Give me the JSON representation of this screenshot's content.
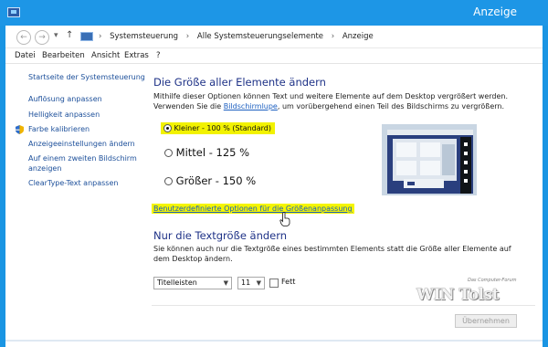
{
  "window": {
    "title": "Anzeige"
  },
  "nav": {
    "back_glyph": "←",
    "forward_glyph": "→",
    "dropdown_glyph": "▾",
    "up_glyph": "↑",
    "breadcrumb": [
      "Systemsteuerung",
      "Alle Systemsteuerungselemente",
      "Anzeige"
    ],
    "separator": "›"
  },
  "menu": [
    "Datei",
    "Bearbeiten",
    "Ansicht",
    "Extras",
    "?"
  ],
  "sidebar": {
    "home": "Startseite der Systemsteuerung",
    "items": [
      {
        "label": "Auflösung anpassen"
      },
      {
        "label": "Helligkeit anpassen"
      },
      {
        "label": "Farbe kalibrieren",
        "icon": "shield-icon"
      },
      {
        "label": "Anzeigeeinstellungen ändern"
      },
      {
        "label": "Auf einem zweiten Bildschirm",
        "label2": "anzeigen"
      },
      {
        "label": "ClearType-Text anpassen"
      }
    ]
  },
  "size_section": {
    "heading": "Die Größe aller Elemente ändern",
    "desc_before": "Mithilfe dieser Optionen können Text und weitere Elemente auf dem Desktop vergrößert werden. Verwenden Sie die ",
    "desc_link": "Bildschirmlupe",
    "desc_after": ", um vorübergehend einen Teil des Bildschirms zu vergrößern.",
    "options": [
      {
        "label": "Kleiner - 100 % (Standard)",
        "selected": true
      },
      {
        "label": "Mittel - 125 %",
        "selected": false
      },
      {
        "label": "Größer - 150 %",
        "selected": false
      }
    ],
    "custom_link": "Benutzerdefinierte Optionen für die Größenanpassung"
  },
  "text_section": {
    "heading": "Nur die Textgröße ändern",
    "desc": "Sie können auch nur die Textgröße eines bestimmten Elements statt die Größe aller Elemente auf dem Desktop ändern.",
    "element_select": "Titelleisten",
    "size_select": "11",
    "bold_label": "Fett",
    "bold_checked": false
  },
  "apply_button": "Übernehmen",
  "watermark": {
    "small": "Das Computer-Forum",
    "big": "WIN Tolst"
  },
  "colors": {
    "titlebar": "#1d96e6",
    "heading": "#1e3287",
    "link": "#1c4f9a",
    "highlight": "#f5f500"
  }
}
